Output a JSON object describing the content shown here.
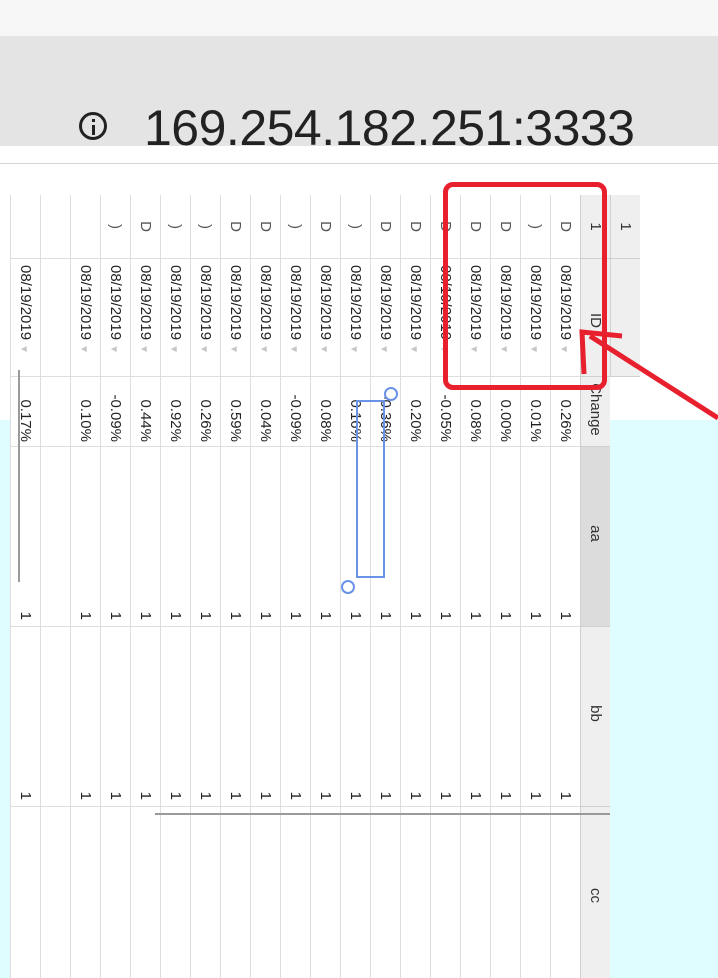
{
  "browser": {
    "url": "169.254.182.251:3333"
  },
  "sheet": {
    "columns": [
      "ID",
      "Change",
      "aa",
      "bb",
      "cc"
    ],
    "header_row_top": "1",
    "header_row_top_id": "1",
    "rows": [
      {
        "id": "D",
        "date": "08/19/2019",
        "change": "0.26%",
        "aa": "1",
        "bb": "1"
      },
      {
        "id": ")",
        "date": "08/19/2019",
        "change": "0.01%",
        "aa": "1",
        "bb": "1"
      },
      {
        "id": "D",
        "date": "08/19/2019",
        "change": "0.00%",
        "aa": "1",
        "bb": "1"
      },
      {
        "id": "D",
        "date": "08/19/2019",
        "change": "0.08%",
        "aa": "1",
        "bb": "1"
      },
      {
        "id": "D",
        "date": "08/19/2019",
        "change": "-0.05%",
        "aa": "1",
        "bb": "1"
      },
      {
        "id": "D",
        "date": "08/19/2019",
        "change": "0.20%",
        "aa": "1",
        "bb": "1"
      },
      {
        "id": "D",
        "date": "08/19/2019",
        "change": "-0.36%",
        "aa": "1",
        "bb": "1"
      },
      {
        "id": ")",
        "date": "08/19/2019",
        "change": "0.16%",
        "aa": "1",
        "bb": "1"
      },
      {
        "id": "D",
        "date": "08/19/2019",
        "change": "0.08%",
        "aa": "1",
        "bb": "1"
      },
      {
        "id": ")",
        "date": "08/19/2019",
        "change": "-0.09%",
        "aa": "1",
        "bb": "1"
      },
      {
        "id": "D",
        "date": "08/19/2019",
        "change": "0.04%",
        "aa": "1",
        "bb": "1"
      },
      {
        "id": "D",
        "date": "08/19/2019",
        "change": "0.59%",
        "aa": "1",
        "bb": "1"
      },
      {
        "id": ")",
        "date": "08/19/2019",
        "change": "0.26%",
        "aa": "1",
        "bb": "1"
      },
      {
        "id": ")",
        "date": "08/19/2019",
        "change": "0.92%",
        "aa": "1",
        "bb": "1"
      },
      {
        "id": "D",
        "date": "08/19/2019",
        "change": "0.44%",
        "aa": "1",
        "bb": "1"
      },
      {
        "id": ")",
        "date": "08/19/2019",
        "change": "-0.09%",
        "aa": "1",
        "bb": "1"
      },
      {
        "id": "",
        "date": "08/19/2019",
        "change": "0.10%",
        "aa": "1",
        "bb": "1"
      },
      {
        "id": "",
        "date": "",
        "change": "",
        "aa": "",
        "bb": ""
      },
      {
        "id": "",
        "date": "08/19/2019",
        "change": "0.17%",
        "aa": "1",
        "bb": "1"
      }
    ]
  },
  "annotations": {
    "highlight_color": "#e8202e",
    "selection_color": "#6a93e8"
  }
}
